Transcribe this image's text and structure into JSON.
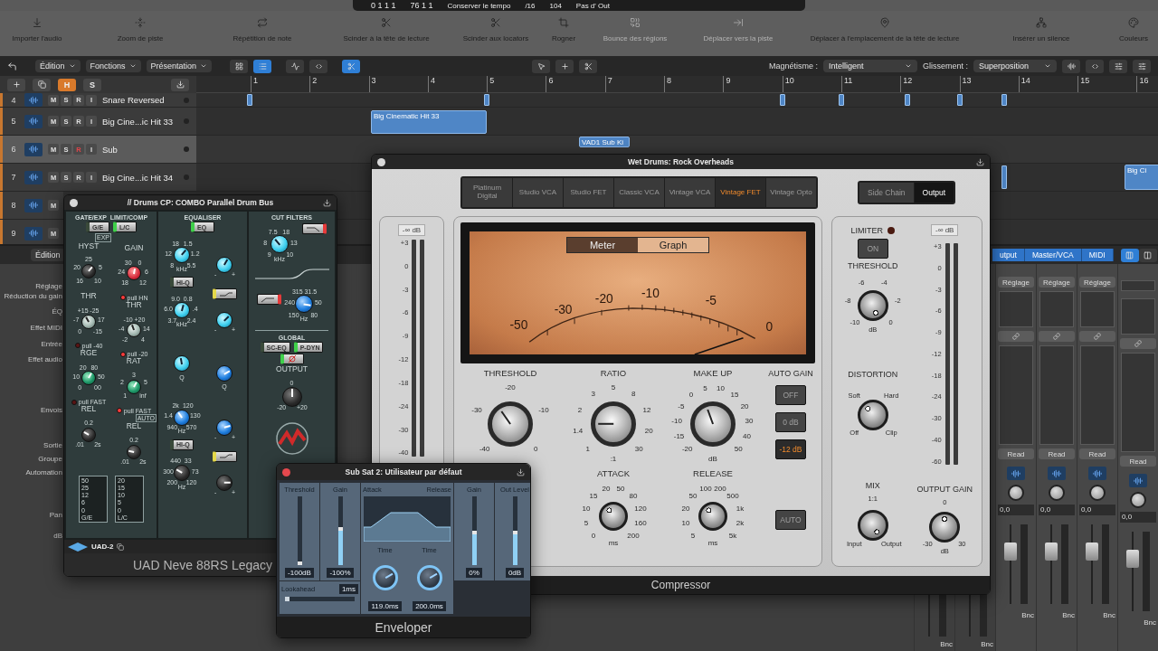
{
  "transport": {
    "position": "0 1 1 1",
    "position_2": "76 1 1",
    "tempo_mode": "Conserver le tempo",
    "division": "/16",
    "tempo": "104",
    "key": "Pas d' Out"
  },
  "toolbar": [
    {
      "label": "Importer l'audio",
      "disabled": false
    },
    {
      "label": "Zoom de piste",
      "disabled": false
    },
    {
      "label": "Répétition de note",
      "disabled": false
    },
    {
      "label": "Scinder à la tête de lecture",
      "disabled": false
    },
    {
      "label": "Scinder aux locators",
      "disabled": false
    },
    {
      "label": "Rogner",
      "disabled": false
    },
    {
      "label": "Bounce des régions",
      "disabled": true
    },
    {
      "label": "Déplacer vers la piste",
      "disabled": true
    },
    {
      "label": "Déplacer à l'emplacement de la tête de lecture",
      "disabled": false
    },
    {
      "label": "Insérer un silence",
      "disabled": false
    },
    {
      "label": "Couleurs",
      "disabled": false
    }
  ],
  "edit_bar": {
    "menus": [
      "Édition",
      "Fonctions",
      "Présentation"
    ],
    "snap_label": "Magnétisme :",
    "snap": "Intelligent",
    "drag_label": "Glissement :",
    "drag": "Superposition"
  },
  "track_header": {
    "buttons": [
      {
        "label": "H",
        "on": true
      },
      {
        "label": "S",
        "on": false
      }
    ]
  },
  "ruler": [
    "1",
    "2",
    "3",
    "4",
    "5",
    "6",
    "7",
    "8",
    "9",
    "10",
    "11",
    "12",
    "13",
    "14",
    "15",
    "16"
  ],
  "tracks": [
    {
      "number": "4",
      "name": "Snare Reversed",
      "selected": false,
      "buttons": [
        "M",
        "S",
        "R",
        "I"
      ],
      "record": false
    },
    {
      "number": "5",
      "name": "Big Cine...ic Hit 33",
      "selected": false,
      "buttons": [
        "M",
        "S",
        "R",
        "I"
      ],
      "record": false,
      "regions": [
        "Big Cinematic Hit 33"
      ]
    },
    {
      "number": "6",
      "name": "Sub",
      "selected": true,
      "buttons": [
        "M",
        "S",
        "R",
        "I"
      ],
      "record": true,
      "regions": [
        "VAD1 Sub Ki"
      ]
    },
    {
      "number": "7",
      "name": "Big Cine...ic Hit 34",
      "selected": false,
      "buttons": [
        "M",
        "S",
        "R",
        "I"
      ],
      "record": false,
      "regions": [
        "Big Ci"
      ]
    },
    {
      "number": "8",
      "selected": false,
      "buttons": [
        "M"
      ]
    },
    {
      "number": "9",
      "selected": false,
      "buttons": [
        "M"
      ]
    }
  ],
  "mixer": {
    "menu": "Édition",
    "tabs": [
      {
        "label": "utput",
        "selected": true
      },
      {
        "label": "Master/VCA",
        "selected": true
      },
      {
        "label": "MIDI",
        "selected": true
      }
    ],
    "row_labels": [
      "Réglage",
      "Réduction du gain",
      "ÉQ",
      "Effet MIDI",
      "Entrée",
      "Effet audio",
      "Envois",
      "Sortie",
      "Groupe",
      "Automation",
      "Pan",
      "dB"
    ],
    "partial_strips": [
      {
        "output": "Bnc"
      },
      {
        "output": "Bnc"
      }
    ],
    "strips": [
      {
        "setting": "Réglage",
        "automation": "Read",
        "pan": "0,0",
        "output": "Bnc"
      },
      {
        "setting": "Réglage",
        "automation": "Read",
        "pan": "0,0",
        "output": "Bnc"
      },
      {
        "setting": "Réglage",
        "automation": "Read",
        "pan": "0,0",
        "output": "Bnc"
      },
      {
        "automation": "Read",
        "pan": "0,0",
        "output": "Bnc"
      }
    ]
  },
  "neve": {
    "title": "// Drums CP: COMBO Parallel Drum Bus",
    "dynamics": {
      "headers": [
        "GATE/EXP",
        "LIMIT/COMP"
      ],
      "switches": [
        {
          "label": "G/E",
          "on": false
        },
        {
          "label": "L/C",
          "on": true
        }
      ],
      "left_knobs": [
        {
          "label": "HYST",
          "kind": "black",
          "scale": [
            "25",
            "20",
            "5",
            "16",
            "10"
          ],
          "tag": "EXP"
        },
        {
          "label": "THR",
          "kind": "grey",
          "scale": [
            "+15",
            "-25",
            "-7",
            "17",
            "0",
            "-15"
          ],
          "pull": {
            "label": "pull -40",
            "on": false
          }
        },
        {
          "label": "RGE",
          "kind": "green",
          "scale": [
            "20",
            "80",
            "10",
            "50",
            "0",
            "00"
          ],
          "pull": {
            "label": "pull FAST",
            "on": false
          }
        },
        {
          "label": "REL",
          "kind": "black",
          "scale": [
            "0.2",
            ".01",
            "2s"
          ]
        }
      ],
      "right_knobs": [
        {
          "label": "GAIN",
          "kind": "red",
          "scale": [
            "30",
            "0",
            "24",
            "6",
            "18",
            "12"
          ],
          "pull": {
            "label": "pull HN",
            "on": true
          }
        },
        {
          "label": "THR",
          "kind": "grey",
          "scale": [
            "-10",
            "+20",
            "-4",
            "14",
            "-2",
            "4"
          ],
          "pull": {
            "label": "pull -20",
            "on": true
          }
        },
        {
          "label": "RAT",
          "kind": "green",
          "scale": [
            "3",
            "2",
            "5",
            "1",
            "inf"
          ],
          "pull": {
            "label": "pull FAST",
            "on": true
          }
        },
        {
          "label": "REL",
          "kind": "black",
          "scale": [
            "0.2",
            ".01",
            "2s"
          ],
          "tag": "AUTO"
        }
      ],
      "meters": [
        {
          "label": "G/E",
          "scale": [
            "50",
            "25",
            "12",
            "6",
            "0"
          ]
        },
        {
          "label": "L/C",
          "scale": [
            "20",
            "15",
            "10",
            "5",
            "0"
          ]
        }
      ]
    },
    "eq": {
      "header": "EQUALISER",
      "switch": {
        "label": "EQ",
        "on": true
      },
      "bands": [
        {
          "freq": {
            "kind": "cyan",
            "scale": [
              "18",
              "1.5",
              "12",
              "1.2",
              "8",
              "5.5"
            ],
            "unit": "kHz"
          },
          "gain": {
            "kind": "cyan",
            "scale": [
              "-",
              "+"
            ]
          },
          "switch": {
            "kind": "text",
            "label": "HI-Q",
            "on": false
          }
        },
        {
          "freq": {
            "kind": "cyan",
            "scale": [
              "9.0",
              "0.8",
              "6.0",
              ".4",
              "3.7",
              "2.4"
            ],
            "unit": "kHz"
          },
          "gain": {
            "kind": "cyan",
            "scale": [
              "-",
              "+"
            ]
          },
          "switch": {
            "kind": "shelf",
            "on": true
          }
        },
        {
          "freq": {
            "kind": "cyan",
            "unit": "Q"
          },
          "gain": {
            "kind": "blue",
            "unit": "Q"
          }
        },
        {
          "freq": {
            "kind": "blue",
            "scale": [
              "2k",
              "120",
              "1.4",
              "130",
              "940",
              "570"
            ],
            "unit": "Hz"
          },
          "gain": {
            "kind": "blue",
            "scale": [
              "-",
              "+"
            ]
          },
          "switch": {
            "kind": "text",
            "label": "HI-Q",
            "on": false
          }
        },
        {
          "freq": {
            "kind": "black",
            "scale": [
              "440",
              "33",
              "300",
              "73",
              "200",
              "120"
            ],
            "unit": "Hz"
          },
          "gain": {
            "kind": "black",
            "scale": [
              "-",
              "+"
            ]
          },
          "switch": {
            "kind": "shelf",
            "on": true
          }
        }
      ]
    },
    "filters": {
      "header": "CUT FILTERS",
      "knobs": [
        {
          "kind": "cyan",
          "scale": [
            "7.5",
            "18",
            "8",
            "13",
            "9",
            "10"
          ],
          "unit": "kHz"
        },
        {
          "kind": "blue",
          "scale": [
            "315",
            "31.5",
            "240",
            "50",
            "150",
            "80"
          ],
          "unit": "Hz"
        }
      ],
      "switches": [
        {
          "kind": "lowpass",
          "on": true
        },
        {
          "kind": "highpass",
          "on": true
        }
      ]
    },
    "global": {
      "header": "GLOBAL",
      "switches": [
        {
          "kind": "text",
          "label": "SC-EQ",
          "on": false
        },
        {
          "kind": "text",
          "label": "P-DYN",
          "on": true
        },
        {
          "kind": "phase",
          "on": true
        }
      ]
    },
    "output": {
      "label": "OUTPUT",
      "kind": "black",
      "scale": [
        "0",
        "-20",
        "+20"
      ]
    },
    "footer": {
      "badge": "UAD-2",
      "name": "UAD Neve 88RS Legacy"
    }
  },
  "compressor": {
    "title": "Wet Drums: Rock Overheads",
    "models": [
      {
        "label": "Platinum Digital",
        "selected": false
      },
      {
        "label": "Studio VCA",
        "selected": false
      },
      {
        "label": "Studio FET",
        "selected": false
      },
      {
        "label": "Classic VCA",
        "selected": false
      },
      {
        "label": "Vintage VCA",
        "selected": false
      },
      {
        "label": "Vintage FET",
        "selected": true
      },
      {
        "label": "Vintage Opto",
        "selected": false
      }
    ],
    "views": [
      {
        "label": "Side Chain",
        "selected": false
      },
      {
        "label": "Output",
        "selected": true
      }
    ],
    "input_meter": {
      "readout": "-∞ dB",
      "scale": [
        "+3",
        "0",
        "-3",
        "-6",
        "-9",
        "-12",
        "-18",
        "-24",
        "-30",
        "-40"
      ]
    },
    "display": {
      "modes": [
        {
          "label": "Meter",
          "selected": true
        },
        {
          "label": "Graph",
          "selected": false
        }
      ],
      "scale": [
        "-50",
        "-30",
        "-20",
        "-10",
        "-5",
        "0"
      ]
    },
    "knobs": [
      {
        "label": "THRESHOLD",
        "kind": "chrome",
        "scale": [
          "-20",
          "-30",
          "-10",
          "-40",
          "0"
        ]
      },
      {
        "label": "RATIO",
        "kind": "chrome",
        "scale": [
          "5",
          "3",
          "8",
          "2",
          "12",
          "1.4",
          "20",
          "1",
          "30"
        ],
        "unit": ":1"
      },
      {
        "label": "MAKE UP",
        "kind": "chrome",
        "scale": [
          "5",
          "10",
          "0",
          "15",
          "-5",
          "20",
          "-10",
          "30",
          "-15",
          "40",
          "-20",
          "50"
        ],
        "unit": "dB"
      },
      {
        "label": "ATTACK",
        "kind": "dark",
        "scale": [
          "20",
          "50",
          "15",
          "80",
          "10",
          "120",
          "5",
          "160",
          "0",
          "200"
        ],
        "unit": "ms"
      },
      {
        "label": "RELEASE",
        "kind": "dark",
        "scale": [
          "100",
          "200",
          "50",
          "500",
          "20",
          "1k",
          "10",
          "2k",
          "5",
          "5k"
        ],
        "unit": "ms"
      }
    ],
    "auto_gain": {
      "label": "AUTO GAIN",
      "options": [
        {
          "label": "OFF",
          "selected": false
        },
        {
          "label": "0 dB",
          "selected": false
        },
        {
          "label": "-12 dB",
          "selected": true
        }
      ],
      "auto": {
        "label": "AUTO",
        "on": false
      }
    },
    "limiter": {
      "label": "LIMITER",
      "led": false,
      "button": "ON",
      "on": false
    },
    "side_knobs": [
      {
        "label": "THRESHOLD",
        "kind": "dark",
        "scale": [
          "-6",
          "-4",
          "-8",
          "-2",
          "-10",
          "0"
        ],
        "unit": "dB"
      },
      {
        "label": "DISTORTION",
        "kind": "dark",
        "scale": [
          "Soft",
          "Hard",
          "Off",
          "Clip"
        ]
      },
      {
        "label": "MIX",
        "kind": "dark",
        "scale": [
          "1:1",
          "Input",
          "Output"
        ]
      },
      {
        "label": "OUTPUT GAIN",
        "kind": "dark",
        "scale": [
          "0",
          "-30",
          "30"
        ],
        "unit": "dB"
      }
    ],
    "output_meter": {
      "readout": "-∞ dB",
      "scale": [
        "+3",
        "0",
        "-3",
        "-6",
        "-9",
        "-12",
        "-18",
        "-24",
        "-30",
        "-40",
        "-60"
      ]
    },
    "footer": "Compressor"
  },
  "enveloper": {
    "title": "Sub Sat 2: Utilisateur par défaut",
    "sliders": [
      {
        "label": "Threshold",
        "value": "-100dB",
        "level": 0.04
      },
      {
        "label": "Gain",
        "value": "-100%",
        "level": 0.55
      }
    ],
    "lookahead": {
      "label": "Lookahead",
      "value": "1ms",
      "level": 0.06
    },
    "graph": {
      "attack_label": "Attack",
      "release_label": "Release"
    },
    "times": [
      {
        "label": "Time",
        "value": "119.0ms",
        "kind": "slate"
      },
      {
        "label": "Time",
        "value": "200.0ms",
        "kind": "slate"
      }
    ],
    "outputs": [
      {
        "label": "Gain",
        "value": "0%",
        "level": 0.5
      },
      {
        "label": "Out Level",
        "value": "0dB",
        "level": 0.5
      }
    ],
    "footer": "Enveloper"
  }
}
